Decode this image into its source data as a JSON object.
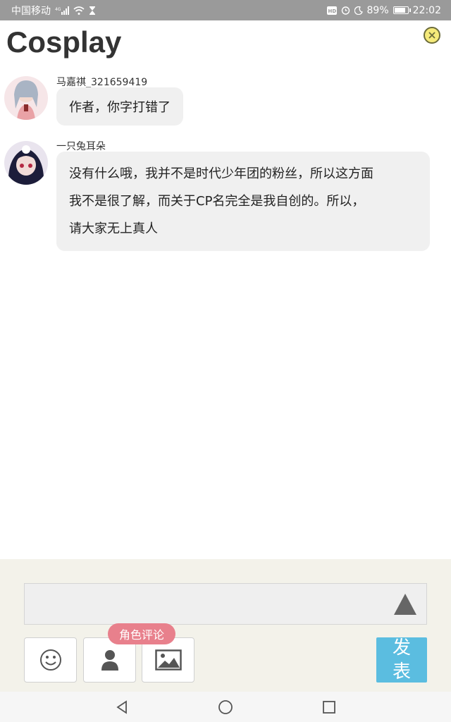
{
  "status_bar": {
    "carrier": "中国移动",
    "network": "4G",
    "battery_percent": "89%",
    "time": "22:02",
    "icons": [
      "signal-icon",
      "wifi-icon",
      "hourglass-icon",
      "hd-icon",
      "alarm-icon",
      "moon-icon",
      "battery-icon"
    ]
  },
  "header": {
    "title": "Cosplay",
    "close_icon": "close-icon",
    "close_color": "#f5ea7a"
  },
  "messages": [
    {
      "username": "马嘉祺_321659419",
      "text": "作者，你字打错了",
      "avatar": "avatar-girl-pink"
    },
    {
      "username": "一只兔耳朵",
      "lines": [
        "没有什么哦，我并不是时代少年团的粉丝，所以这方面",
        "我不是很了解，而关于CP名完全是我自创的。所以，",
        "请大家无上真人"
      ],
      "avatar": "avatar-dark-hair"
    }
  ],
  "composer": {
    "input_value": "",
    "send_arrow_icon": "send-arrow-icon",
    "tools": [
      {
        "name": "emoji-button",
        "icon": "smiley-icon"
      },
      {
        "name": "character-button",
        "icon": "person-icon"
      },
      {
        "name": "image-button",
        "icon": "image-icon"
      }
    ],
    "tooltip": "角色评论",
    "send_label_line1": "发",
    "send_label_line2": "表",
    "send_color": "#5bbde0",
    "tooltip_color": "#e8808c"
  },
  "navbar": {
    "buttons": [
      "back-icon",
      "home-icon",
      "recents-icon"
    ]
  }
}
